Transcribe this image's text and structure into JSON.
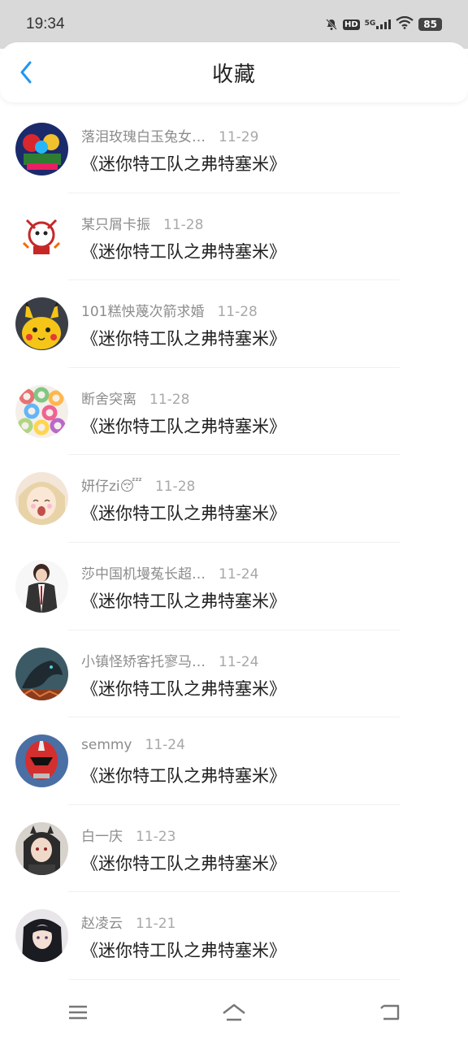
{
  "status_bar": {
    "time": "19:34",
    "hd_label": "HD",
    "network_label": "5G",
    "battery": "85",
    "icons": [
      "bell-off-icon",
      "hd-icon",
      "signal-icon",
      "wifi-icon",
      "battery-icon"
    ]
  },
  "header": {
    "title": "收藏",
    "back_icon": "chevron-left-icon",
    "accent_color": "#2196f3"
  },
  "items": [
    {
      "user": "落泪玫瑰白玉兔女…",
      "date": "11-29",
      "title": "《迷你特工队之弗特塞米》",
      "avatar": "robot-heroes-avatar"
    },
    {
      "user": "某只屑卡振",
      "date": "11-28",
      "title": "《迷你特工队之弗特塞米》",
      "avatar": "cartoon-character-avatar"
    },
    {
      "user": "101糕怏蔑次箭求婚",
      "date": "11-28",
      "title": "《迷你特工队之弗特塞米》",
      "avatar": "pikachu-avatar"
    },
    {
      "user": "断舍突离",
      "date": "11-28",
      "title": "《迷你特工队之弗特塞米》",
      "avatar": "donuts-avatar"
    },
    {
      "user": "妍仔zi😴",
      "date": "11-28",
      "title": "《迷你特工队之弗特塞米》",
      "avatar": "anime-girl-avatar"
    },
    {
      "user": "莎中国机墁菟长超…",
      "date": "11-24",
      "title": "《迷你特工队之弗特塞米》",
      "avatar": "suit-character-avatar"
    },
    {
      "user": "小镇怪矫客托寥马…",
      "date": "11-24",
      "title": "《迷你特工队之弗特塞米》",
      "avatar": "dark-dragon-avatar"
    },
    {
      "user": "semmy",
      "date": "11-24",
      "title": "《迷你特工队之弗特塞米》",
      "avatar": "red-ranger-avatar"
    },
    {
      "user": "白一庆",
      "date": "11-23",
      "title": "《迷你特工队之弗特塞米》",
      "avatar": "dark-anime-girl-avatar"
    },
    {
      "user": "赵凌云",
      "date": "11-21",
      "title": "《迷你特工队之弗特塞米》",
      "avatar": "dark-hair-anime-avatar"
    }
  ],
  "nav_bar": {
    "icons": [
      "menu-icon",
      "home-icon",
      "back-icon"
    ]
  }
}
